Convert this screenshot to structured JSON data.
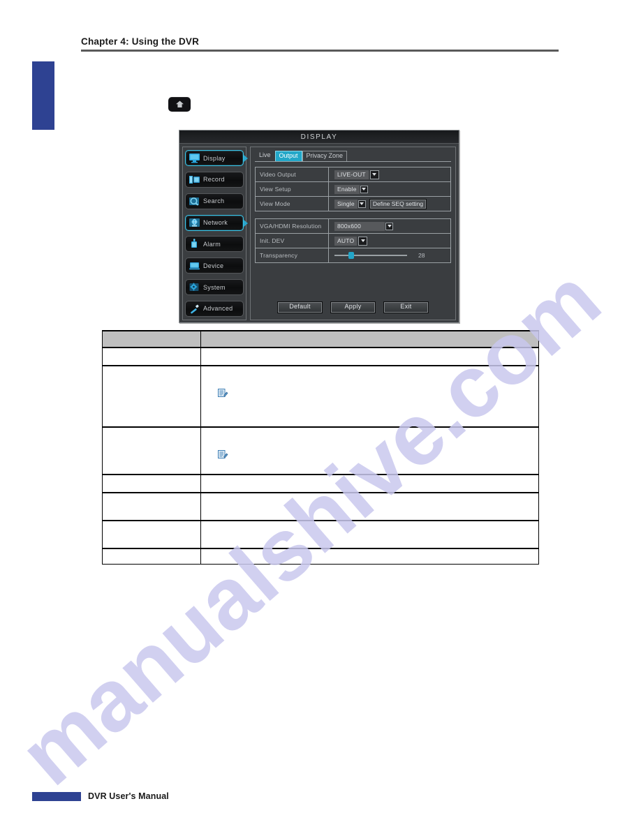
{
  "page": {
    "chapter_title": "Chapter 4: Using the DVR",
    "footer_text": "DVR User's Manual",
    "watermark": "manualshive.com",
    "home_button_icon": "home-up-icon"
  },
  "dvr": {
    "title": "DISPLAY",
    "sidebar": {
      "items": [
        {
          "label": "Display",
          "icon": "monitor-icon",
          "active": true
        },
        {
          "label": "Record",
          "icon": "recorder-icon",
          "active": false
        },
        {
          "label": "Search",
          "icon": "magnifier-icon",
          "active": false
        },
        {
          "label": "Network",
          "icon": "globe-icon",
          "active": true
        },
        {
          "label": "Alarm",
          "icon": "siren-icon",
          "active": false
        },
        {
          "label": "Device",
          "icon": "device-icon",
          "active": false
        },
        {
          "label": "System",
          "icon": "gear-icon",
          "active": false
        },
        {
          "label": "Advanced",
          "icon": "wrench-icon",
          "active": false
        }
      ]
    },
    "tabs": [
      {
        "label": "Live",
        "selected": false
      },
      {
        "label": "Output",
        "selected": true
      },
      {
        "label": "Privacy Zone",
        "selected": false
      }
    ],
    "fields_top": [
      {
        "label": "Video Output",
        "value": "LIVE-OUT"
      },
      {
        "label": "View Setup",
        "value": "Enable"
      },
      {
        "label": "View Mode",
        "value": "Single",
        "extra_button": "Define SEQ setting"
      }
    ],
    "fields_bottom": [
      {
        "label": "VGA/HDMI Resolution",
        "value": "800x600"
      },
      {
        "label": "Init. DEV",
        "value": "AUTO"
      }
    ],
    "transparency": {
      "label": "Transparency",
      "value": "28",
      "percent": 19
    },
    "buttons": [
      {
        "label": "Default"
      },
      {
        "label": "Apply"
      },
      {
        "label": "Exit"
      }
    ],
    "colors": {
      "accent": "#22a7c8",
      "panel": "#3a3d40",
      "titlebar": "#17191b",
      "text": "#c9ccd0"
    }
  },
  "spec_table": {
    "headers": [
      "",
      ""
    ],
    "rows": [
      {
        "label": "",
        "value": "",
        "height": "r-h26",
        "note": false
      },
      {
        "label": "",
        "value": "",
        "height": "r-h88",
        "note": true
      },
      {
        "label": "",
        "value": "",
        "height": "r-h68",
        "note": true
      },
      {
        "label": "",
        "value": "",
        "height": "r-h26",
        "note": false
      },
      {
        "label": "",
        "value": "",
        "height": "r-h40",
        "note": false
      },
      {
        "label": "",
        "value": "",
        "height": "r-h40",
        "note": false
      },
      {
        "label": "",
        "value": "",
        "height": "r-h22",
        "note": false
      }
    ]
  }
}
